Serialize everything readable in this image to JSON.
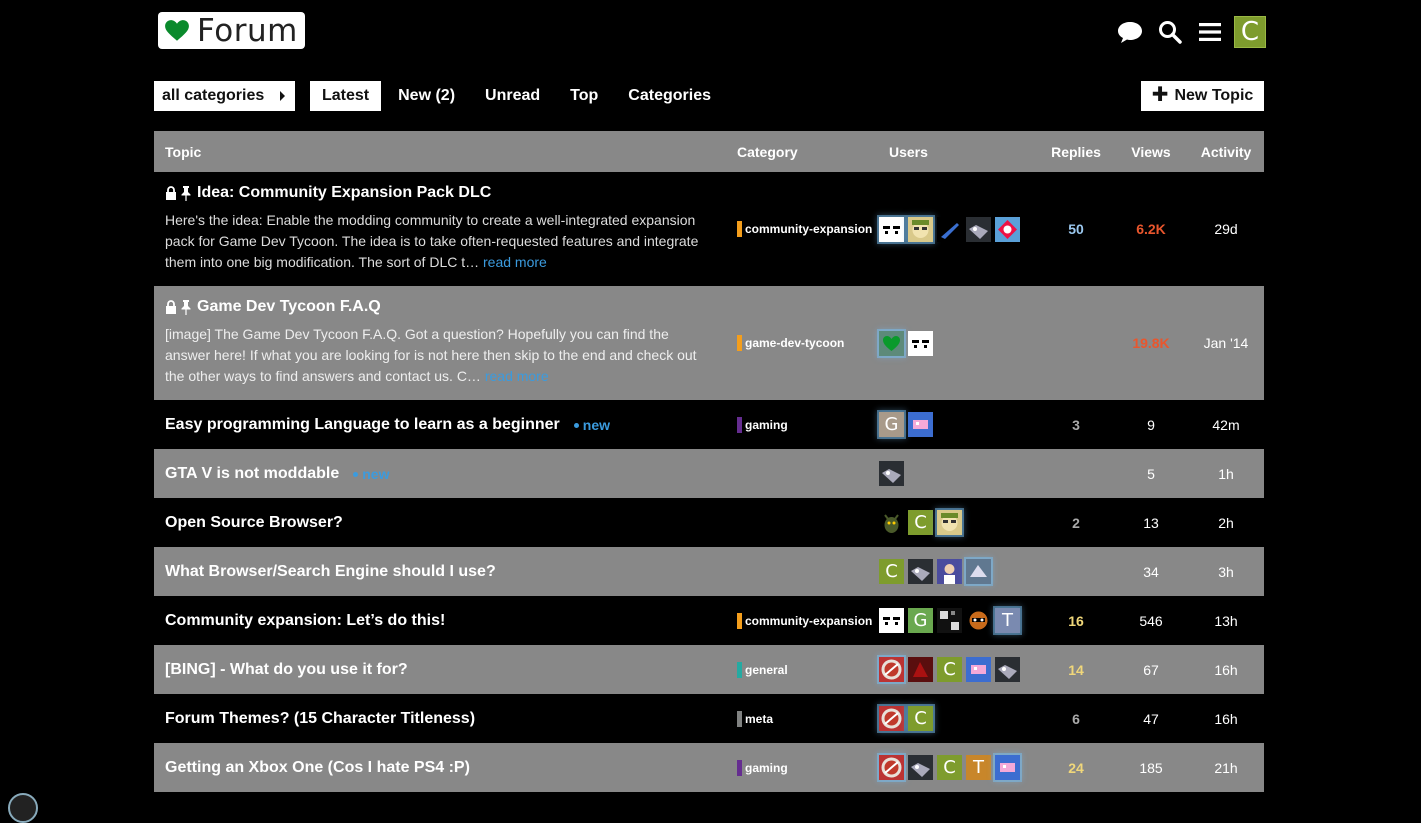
{
  "header": {
    "logo_text": "Forum",
    "icons": [
      "chat-icon",
      "search-icon",
      "hamburger-icon"
    ],
    "user_initial": "C"
  },
  "nav": {
    "category_select": "all categories",
    "tabs": [
      "Latest",
      "New (2)",
      "Unread",
      "Top",
      "Categories"
    ],
    "active_tab": "Latest",
    "new_topic_label": "New Topic"
  },
  "table": {
    "headers": {
      "topic": "Topic",
      "category": "Category",
      "users": "Users",
      "replies": "Replies",
      "views": "Views",
      "activity": "Activity"
    },
    "rows": [
      {
        "title": "Idea: Community Expansion Pack DLC",
        "excerpt": "Here's the idea: Enable the modding community to create a well-integrated expansion pack for Game Dev Tycoon. The idea is to take often-requested features and integrate them into one big modification. The sort of DLC t…",
        "read_more": "read more",
        "category": "community-expansion",
        "category_color": "#f49e1c",
        "replies": "50",
        "views": "6.2K",
        "activity": "29d"
      },
      {
        "title": "Game Dev Tycoon F.A.Q",
        "excerpt": "[image] The Game Dev Tycoon F.A.Q. Got a question? Hopefully you can find the answer here! If what you are looking for is not here then skip to the end and check out the other ways to find answers and contact us. C…",
        "read_more": "read more",
        "category": "game-dev-tycoon",
        "category_color": "#f49e1c",
        "replies": "",
        "views": "19.8K",
        "activity": "Jan '14"
      },
      {
        "title": "Easy programming Language to learn as a beginner",
        "new_label": "new",
        "category": "gaming",
        "category_color": "#652d90",
        "replies": "3",
        "views": "9",
        "activity": "42m"
      },
      {
        "title": "GTA V is not moddable",
        "new_label": "new",
        "category": "",
        "replies": "",
        "views": "5",
        "activity": "1h"
      },
      {
        "title": "Open Source Browser?",
        "category": "",
        "replies": "2",
        "views": "13",
        "activity": "2h"
      },
      {
        "title": "What Browser/Search Engine should I use?",
        "category": "",
        "replies": "",
        "views": "34",
        "activity": "3h"
      },
      {
        "title": "Community expansion: Let’s do this!",
        "category": "community-expansion",
        "category_color": "#f49e1c",
        "replies": "16",
        "views": "546",
        "activity": "13h"
      },
      {
        "title": "[BING] - What do you use it for?",
        "category": "general",
        "category_color": "#25aaa2",
        "replies": "14",
        "views": "67",
        "activity": "16h"
      },
      {
        "title": "Forum Themes? (15 Character Titleness)",
        "category": "meta",
        "category_color": "#808281",
        "replies": "6",
        "views": "47",
        "activity": "16h"
      },
      {
        "title": "Getting an Xbox One (Cos I hate PS4 :P)",
        "category": "gaming",
        "category_color": "#652d90",
        "replies": "24",
        "views": "185",
        "activity": "21h"
      }
    ]
  },
  "colors": {
    "accent_blue": "#3b9bde",
    "hot_views": "#e9562d",
    "row_gray": "#888888",
    "avatar_green": "#7e9c2d"
  }
}
